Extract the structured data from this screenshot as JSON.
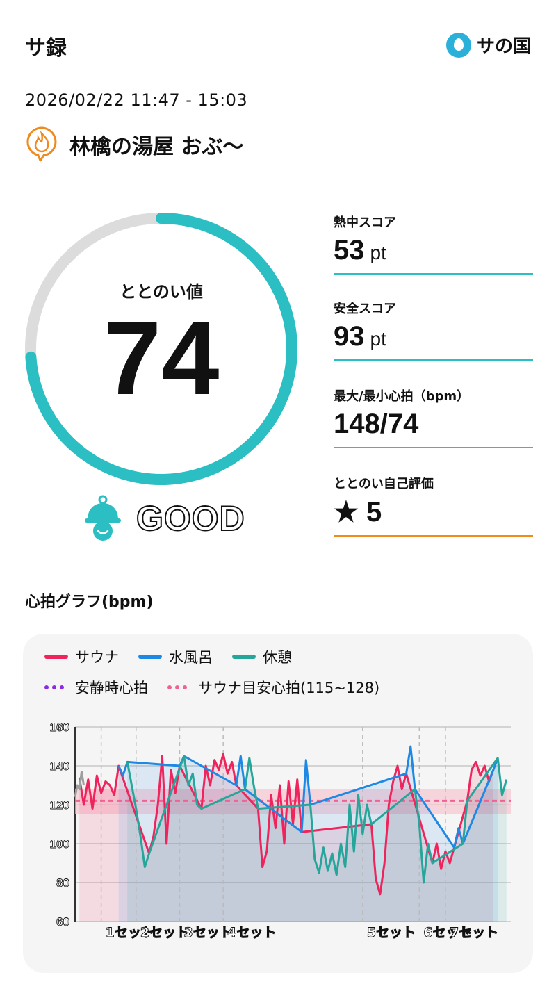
{
  "header": {
    "title": "サ録",
    "brand": "サの国",
    "brand_icon": "water-drop-icon"
  },
  "session": {
    "datetime": "2026/02/22 11:47 - 15:03",
    "facility": "林檎の湯屋 おぶ〜",
    "facility_icon": "fire-pin-icon"
  },
  "gauge": {
    "label": "ととのい値",
    "value": "74",
    "max": 100,
    "track_color": "#dcdcdc",
    "fill_color": "#2bbec2"
  },
  "mood": {
    "icon": "smiling-hat-face-icon",
    "label": "GOOD"
  },
  "metrics": [
    {
      "label": "熱中スコア",
      "value": "53",
      "unit": "pt"
    },
    {
      "label": "安全スコア",
      "value": "93",
      "unit": "pt"
    },
    {
      "label": "最大/最小心拍（bpm）",
      "value": "148/74",
      "unit": ""
    },
    {
      "label": "ととのい自己評価",
      "value": "★ 5",
      "unit": ""
    }
  ],
  "graph": {
    "title": "心拍グラフ(bpm)",
    "legend": [
      {
        "label": "サウナ",
        "color": "#f0245c",
        "style": "solid"
      },
      {
        "label": "水風呂",
        "color": "#1e88e5",
        "style": "solid"
      },
      {
        "label": "休憩",
        "color": "#26a69a",
        "style": "solid"
      },
      {
        "label": "安静時心拍",
        "color": "#8a2be2",
        "style": "dotted"
      },
      {
        "label": "サウナ目安心拍(115~128)",
        "color": "#f06292",
        "style": "dotted"
      }
    ]
  },
  "chart_data": {
    "type": "line",
    "ylim": [
      60,
      160
    ],
    "yticks": [
      60,
      80,
      100,
      120,
      140,
      160
    ],
    "guide_band": [
      115,
      128
    ],
    "guide_line": 122,
    "set_labels": [
      "1セット",
      "2セット",
      "3セット",
      "4セット",
      "5セット",
      "6セット",
      "7セット"
    ],
    "series": [
      {
        "name": "サウナ",
        "color": "#f0245c",
        "values": [
          [
            2,
            134
          ],
          [
            4,
            120
          ],
          [
            6,
            133
          ],
          [
            8,
            118
          ],
          [
            10,
            135
          ],
          [
            12,
            126
          ],
          [
            14,
            132
          ],
          [
            16,
            130
          ],
          [
            18,
            125
          ],
          [
            20,
            140
          ],
          [
            34,
            95
          ],
          [
            36,
            104
          ],
          [
            38,
            120
          ],
          [
            40,
            145
          ],
          [
            42,
            100
          ],
          [
            44,
            138
          ],
          [
            46,
            126
          ],
          [
            48,
            140
          ],
          [
            58,
            118
          ],
          [
            60,
            140
          ],
          [
            62,
            130
          ],
          [
            64,
            143
          ],
          [
            66,
            138
          ],
          [
            68,
            146
          ],
          [
            70,
            136
          ],
          [
            72,
            142
          ],
          [
            74,
            130
          ],
          [
            84,
            118
          ],
          [
            86,
            88
          ],
          [
            88,
            96
          ],
          [
            90,
            125
          ],
          [
            92,
            108
          ],
          [
            94,
            130
          ],
          [
            96,
            100
          ],
          [
            98,
            132
          ],
          [
            100,
            110
          ],
          [
            102,
            133
          ],
          [
            104,
            106
          ],
          [
            136,
            110
          ],
          [
            138,
            82
          ],
          [
            140,
            74
          ],
          [
            142,
            90
          ],
          [
            144,
            120
          ],
          [
            146,
            132
          ],
          [
            148,
            140
          ],
          [
            150,
            128
          ],
          [
            152,
            136
          ],
          [
            164,
            90
          ],
          [
            166,
            100
          ],
          [
            168,
            87
          ],
          [
            170,
            96
          ],
          [
            172,
            90
          ],
          [
            174,
            98
          ],
          [
            180,
            122
          ],
          [
            182,
            138
          ],
          [
            184,
            142
          ],
          [
            186,
            135
          ],
          [
            188,
            140
          ],
          [
            190,
            132
          ],
          [
            192,
            138
          ]
        ]
      },
      {
        "name": "水風呂",
        "color": "#1e88e5",
        "values": [
          [
            20,
            140
          ],
          [
            22,
            135
          ],
          [
            24,
            142
          ],
          [
            48,
            140
          ],
          [
            50,
            145
          ],
          [
            74,
            130
          ],
          [
            76,
            145
          ],
          [
            78,
            128
          ],
          [
            104,
            106
          ],
          [
            106,
            143
          ],
          [
            108,
            120
          ],
          [
            152,
            136
          ],
          [
            154,
            150
          ],
          [
            156,
            128
          ],
          [
            174,
            98
          ],
          [
            176,
            108
          ],
          [
            178,
            100
          ],
          [
            192,
            138
          ],
          [
            194,
            144
          ]
        ]
      },
      {
        "name": "休憩",
        "color": "#26a69a",
        "values": [
          [
            24,
            142
          ],
          [
            26,
            130
          ],
          [
            28,
            118
          ],
          [
            30,
            104
          ],
          [
            32,
            88
          ],
          [
            34,
            95
          ],
          [
            50,
            145
          ],
          [
            52,
            130
          ],
          [
            54,
            136
          ],
          [
            56,
            120
          ],
          [
            58,
            118
          ],
          [
            78,
            128
          ],
          [
            80,
            144
          ],
          [
            82,
            130
          ],
          [
            84,
            118
          ],
          [
            108,
            120
          ],
          [
            110,
            92
          ],
          [
            112,
            85
          ],
          [
            114,
            98
          ],
          [
            116,
            86
          ],
          [
            118,
            95
          ],
          [
            120,
            84
          ],
          [
            122,
            100
          ],
          [
            124,
            88
          ],
          [
            126,
            120
          ],
          [
            128,
            96
          ],
          [
            130,
            125
          ],
          [
            132,
            105
          ],
          [
            134,
            120
          ],
          [
            136,
            110
          ],
          [
            156,
            128
          ],
          [
            158,
            110
          ],
          [
            160,
            80
          ],
          [
            162,
            100
          ],
          [
            164,
            90
          ],
          [
            178,
            100
          ],
          [
            180,
            122
          ],
          [
            194,
            144
          ],
          [
            196,
            125
          ],
          [
            198,
            133
          ]
        ]
      },
      {
        "name": "安静時心拍",
        "color": "#9e9e9e",
        "values": [
          [
            0,
            124
          ],
          [
            1,
            130
          ],
          [
            2,
            128
          ],
          [
            3,
            137
          ],
          [
            4,
            130
          ]
        ]
      }
    ],
    "x_range": [
      0,
      200
    ],
    "set_boundaries": [
      12,
      28,
      48,
      68,
      132,
      158,
      170
    ]
  }
}
